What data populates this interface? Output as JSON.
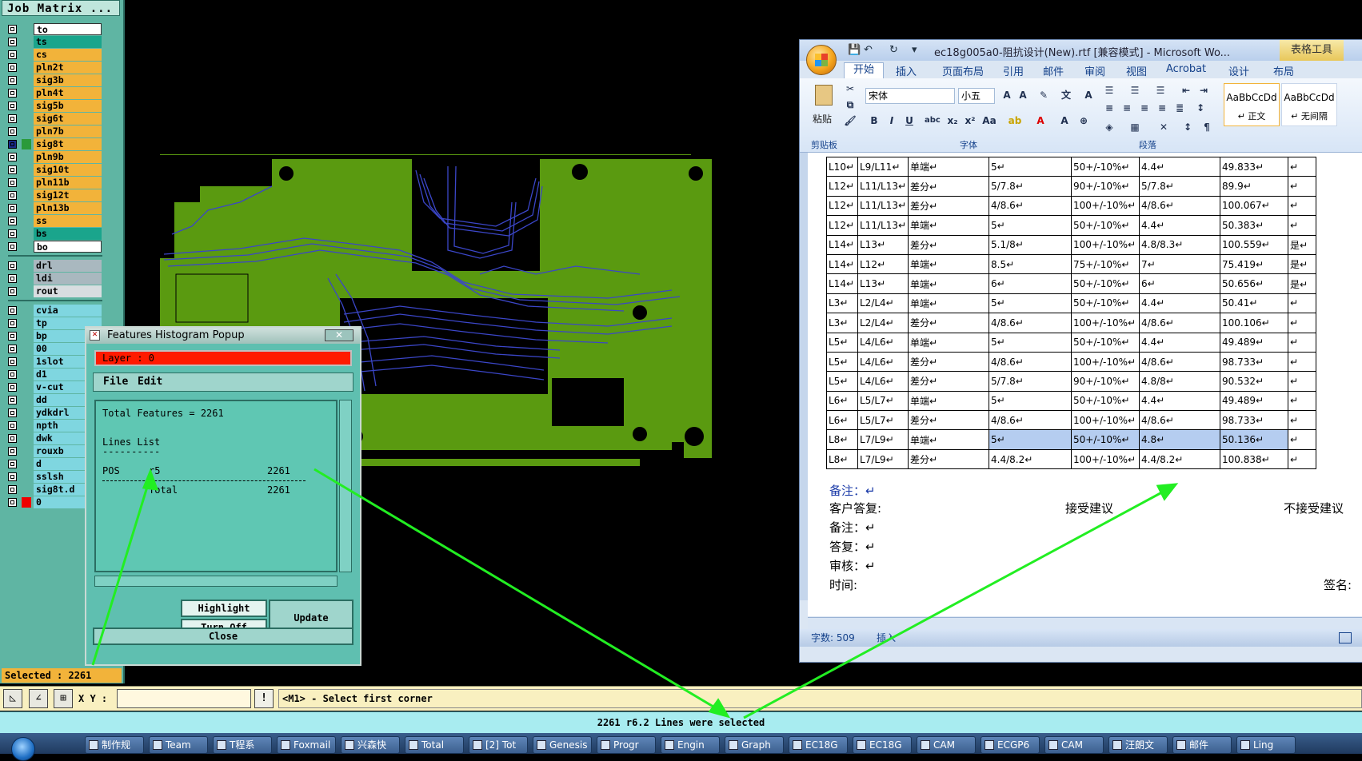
{
  "matrix": {
    "title": "Job Matrix ...",
    "layers": [
      {
        "name": "to",
        "color": "#ffffff",
        "mark": "pen"
      },
      {
        "name": "ts",
        "color": "#1aa58c"
      },
      {
        "name": "cs",
        "color": "#f2b33a"
      },
      {
        "name": "pln2t",
        "color": "#f2b33a"
      },
      {
        "name": "sig3b",
        "color": "#f2b33a"
      },
      {
        "name": "pln4t",
        "color": "#f2b33a"
      },
      {
        "name": "sig5b",
        "color": "#f2b33a"
      },
      {
        "name": "sig6t",
        "color": "#f2b33a"
      },
      {
        "name": "pln7b",
        "color": "#f2b33a"
      },
      {
        "name": "sig8t",
        "color": "#f2b33a",
        "mark": "active"
      },
      {
        "name": "pln9b",
        "color": "#f2b33a"
      },
      {
        "name": "sig10t",
        "color": "#f2b33a"
      },
      {
        "name": "pln11b",
        "color": "#f2b33a"
      },
      {
        "name": "sig12t",
        "color": "#f2b33a"
      },
      {
        "name": "pln13b",
        "color": "#f2b33a"
      },
      {
        "name": "ss",
        "color": "#f2b33a"
      },
      {
        "name": "bs",
        "color": "#1aa58c"
      },
      {
        "name": "bo",
        "color": "#ffffff",
        "mark": "pen"
      }
    ],
    "drill_layers": [
      {
        "name": "drl",
        "color": "#a9b8bf"
      },
      {
        "name": "ldi",
        "color": "#a9b8bf"
      },
      {
        "name": "rout",
        "color": "#d8dde0"
      }
    ],
    "misc_layers": [
      {
        "name": "cvia",
        "color": "#7fd6e0"
      },
      {
        "name": "tp",
        "color": "#7fd6e0"
      },
      {
        "name": "bp",
        "color": "#7fd6e0"
      },
      {
        "name": "00",
        "color": "#7fd6e0"
      },
      {
        "name": "1slot",
        "color": "#7fd6e0"
      },
      {
        "name": "d1",
        "color": "#7fd6e0"
      },
      {
        "name": "v-cut",
        "color": "#7fd6e0"
      },
      {
        "name": "dd",
        "color": "#7fd6e0"
      },
      {
        "name": "ydkdrl",
        "color": "#7fd6e0"
      },
      {
        "name": "npth",
        "color": "#7fd6e0"
      },
      {
        "name": "dwk",
        "color": "#7fd6e0"
      },
      {
        "name": "rouxb",
        "color": "#7fd6e0"
      },
      {
        "name": "d",
        "color": "#7fd6e0"
      },
      {
        "name": "sslsh",
        "color": "#7fd6e0"
      },
      {
        "name": "sig8t.d",
        "color": "#7fd6e0"
      },
      {
        "name": "0",
        "color": "#7fd6e0",
        "mark": "red"
      }
    ],
    "selected": "Selected : 2261"
  },
  "popup": {
    "title": "Features Histogram Popup",
    "close_label": "✕",
    "layer_label": "Layer :  0",
    "menu": {
      "file": "File",
      "edit": "Edit"
    },
    "total_features": "Total Features = 2261",
    "lines_list": "Lines List",
    "lines_underline": "----------",
    "row": {
      "polarity": "POS",
      "symbol": "r5",
      "count": "2261"
    },
    "total": {
      "label": "Total",
      "count": "2261"
    },
    "buttons": {
      "highlight": "Highlight",
      "turn_off": "Turn Off",
      "update": "Update",
      "close": "Close"
    }
  },
  "word": {
    "doc_title": "ec18g005a0-阻抗设计(New).rtf [兼容模式] - Microsoft Wo...",
    "table_tools": "表格工具",
    "tabs": [
      "开始",
      "插入",
      "页面布局",
      "引用",
      "邮件",
      "审阅",
      "视图",
      "Acrobat",
      "设计",
      "布局"
    ],
    "clipboard": {
      "paste": "粘贴",
      "group": "剪贴板"
    },
    "font": {
      "name": "宋体",
      "size": "小五",
      "group": "字体"
    },
    "paragraph_group": "段落",
    "styles": [
      {
        "sample": "AaBbCcDd",
        "name": "↵ 正文"
      },
      {
        "sample": "AaBbCcDd",
        "name": "↵ 无间隔"
      }
    ],
    "table_rows": [
      [
        "L10↵",
        "L9/L11↵",
        "单端↵",
        "5↵",
        "50+/-10%↵",
        "4.4↵",
        "49.833↵",
        "↵"
      ],
      [
        "L12↵",
        "L11/L13↵",
        "差分↵",
        "5/7.8↵",
        "90+/-10%↵",
        "5/7.8↵",
        "89.9↵",
        "↵"
      ],
      [
        "L12↵",
        "L11/L13↵",
        "差分↵",
        "4/8.6↵",
        "100+/-10%↵",
        "4/8.6↵",
        "100.067↵",
        "↵"
      ],
      [
        "L12↵",
        "L11/L13↵",
        "单端↵",
        "5↵",
        "50+/-10%↵",
        "4.4↵",
        "50.383↵",
        "↵"
      ],
      [
        "L14↵",
        "L13↵",
        "差分↵",
        "5.1/8↵",
        "100+/-10%↵",
        "4.8/8.3↵",
        "100.559↵",
        "是↵"
      ],
      [
        "L14↵",
        "L12↵",
        "单端↵",
        "8.5↵",
        "75+/-10%↵",
        "7↵",
        "75.419↵",
        "是↵"
      ],
      [
        "L14↵",
        "L13↵",
        "单端↵",
        "6↵",
        "50+/-10%↵",
        "6↵",
        "50.656↵",
        "是↵"
      ],
      [
        "L3↵",
        "L2/L4↵",
        "单端↵",
        "5↵",
        "50+/-10%↵",
        "4.4↵",
        "50.41↵",
        "↵"
      ],
      [
        "L3↵",
        "L2/L4↵",
        "差分↵",
        "4/8.6↵",
        "100+/-10%↵",
        "4/8.6↵",
        "100.106↵",
        "↵"
      ],
      [
        "L5↵",
        "L4/L6↵",
        "单端↵",
        "5↵",
        "50+/-10%↵",
        "4.4↵",
        "49.489↵",
        "↵"
      ],
      [
        "L5↵",
        "L4/L6↵",
        "差分↵",
        "4/8.6↵",
        "100+/-10%↵",
        "4/8.6↵",
        "98.733↵",
        "↵"
      ],
      [
        "L5↵",
        "L4/L6↵",
        "差分↵",
        "5/7.8↵",
        "90+/-10%↵",
        "4.8/8↵",
        "90.532↵",
        "↵"
      ],
      [
        "L6↵",
        "L5/L7↵",
        "单端↵",
        "5↵",
        "50+/-10%↵",
        "4.4↵",
        "49.489↵",
        "↵"
      ],
      [
        "L6↵",
        "L5/L7↵",
        "差分↵",
        "4/8.6↵",
        "100+/-10%↵",
        "4/8.6↵",
        "98.733↵",
        "↵"
      ],
      [
        "L8↵",
        "L7/L9↵",
        "单端↵",
        "5↵",
        "50+/-10%↵",
        "4.8↵",
        "50.136↵",
        "↵"
      ],
      [
        "L8↵",
        "L7/L9↵",
        "差分↵",
        "4.4/8.2↵",
        "100+/-10%↵",
        "4.4/8.2↵",
        "100.838↵",
        "↵"
      ]
    ],
    "notes": {
      "remark1": "备注：↵",
      "customer_reply": "客户答复:",
      "accept": "接受建议",
      "reject": "不接受建议",
      "remark2": "备注：↵",
      "reply": "答复：↵",
      "review": "审核：↵",
      "time": "时间:",
      "sign": "签名:"
    },
    "status": {
      "words": "字数: 509",
      "insert": "插入"
    }
  },
  "cmd": {
    "xy_label": "X Y :",
    "xy_value": "",
    "excl": "!",
    "prompt": "<M1> - Select first corner",
    "message": "2261 r6.2 Lines were selected"
  },
  "taskbar": {
    "items": [
      "制作规",
      "Team",
      "T程系",
      "Foxmail",
      "兴森快",
      "Total",
      "[2] Tot",
      "Genesis",
      "Progr",
      "Engin",
      "Graph",
      "EC18G",
      "EC18G",
      "CAM",
      "ECGP6",
      "CAM",
      "汪朗文",
      "邮件",
      "Ling"
    ]
  },
  "colors": {
    "pcb_green": "#5a9a10",
    "trace_blue": "#3b46c8",
    "arrow_green": "#22ee22",
    "word_selection": "#b5cdf0"
  }
}
